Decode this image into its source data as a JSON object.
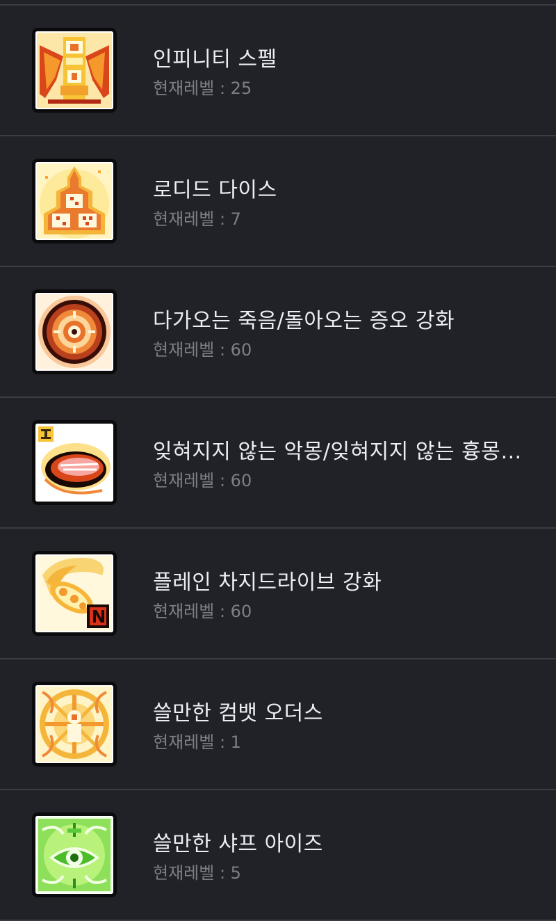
{
  "level_label": "현재레벨 : ",
  "skills": [
    {
      "name": "인피니티 스펠",
      "level": "25",
      "icon": "infinity-spell-icon"
    },
    {
      "name": "로디드 다이스",
      "level": "7",
      "icon": "loaded-dice-icon"
    },
    {
      "name": "다가오는 죽음/돌아오는 증오 강화",
      "level": "60",
      "icon": "approaching-death-icon"
    },
    {
      "name": "잊혀지지 않는 악몽/잊혀지지 않는 흉몽…",
      "level": "60",
      "icon": "unforgettable-nightmare-icon"
    },
    {
      "name": "플레인 차지드라이브 강화",
      "level": "60",
      "icon": "plain-chargedrive-icon"
    },
    {
      "name": "쓸만한 컴뱃 오더스",
      "level": "1",
      "icon": "combat-orders-icon"
    },
    {
      "name": "쓸만한 샤프 아이즈",
      "level": "5",
      "icon": "sharp-eyes-icon"
    }
  ],
  "colors": {
    "background": "#212227",
    "divider": "#3b3c44",
    "name_text": "#eceef3",
    "level_text": "#7c7f89"
  }
}
